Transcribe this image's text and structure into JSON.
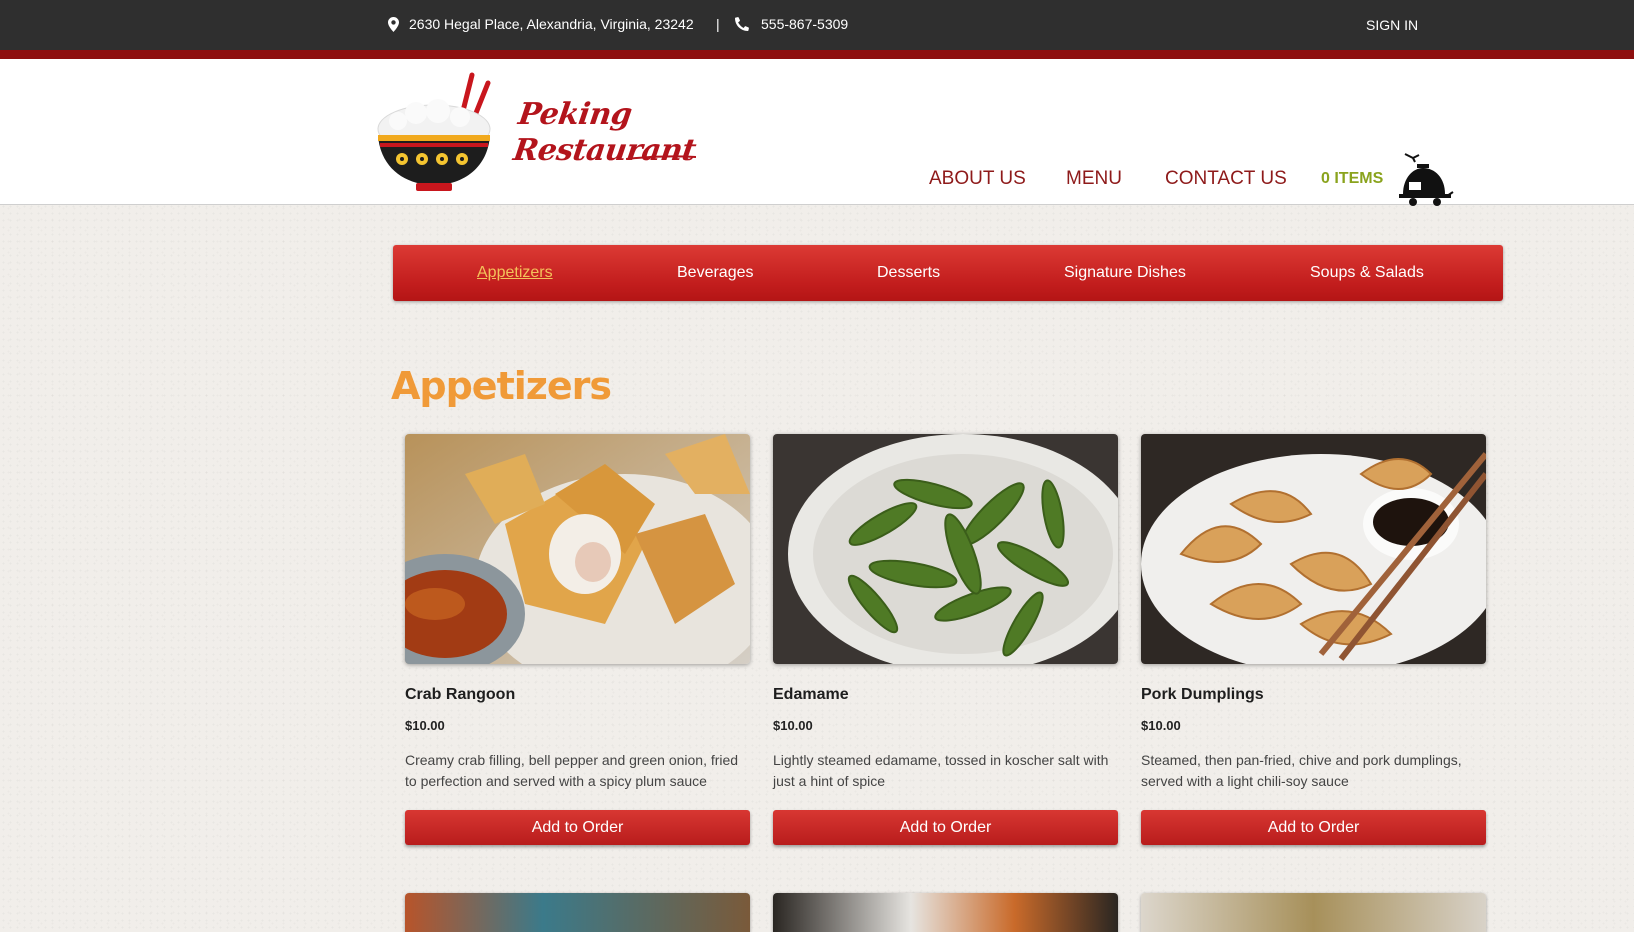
{
  "topbar": {
    "address": "2630 Hegal Place, Alexandria, Virginia, 23242",
    "separator": "|",
    "phone": "555-867-5309",
    "sign_in": "SIGN IN"
  },
  "header": {
    "logo_line1": "Peking",
    "logo_line2": "Restaurant",
    "nav": {
      "about": "ABOUT US",
      "menu": "MENU",
      "contact": "CONTACT US"
    },
    "cart_label": "0 ITEMS"
  },
  "categories": [
    {
      "label": "Appetizers",
      "active": true
    },
    {
      "label": "Beverages",
      "active": false
    },
    {
      "label": "Desserts",
      "active": false
    },
    {
      "label": "Signature Dishes",
      "active": false
    },
    {
      "label": "Soups & Salads",
      "active": false
    }
  ],
  "section_title": "Appetizers",
  "items": [
    {
      "name": "Crab Rangoon",
      "price": "$10.00",
      "description": "Creamy crab filling, bell pepper and green onion, fried to perfection and served with a spicy plum sauce",
      "button": "Add to Order"
    },
    {
      "name": "Edamame",
      "price": "$10.00",
      "description": "Lightly steamed edamame, tossed in koscher salt with just a hint of spice",
      "button": "Add to Order"
    },
    {
      "name": "Pork Dumplings",
      "price": "$10.00",
      "description": "Steamed, then pan-fried, chive and pork dumplings, served with a light chili-soy sauce",
      "button": "Add to Order"
    }
  ],
  "colors": {
    "topbar": "#2f2f2f",
    "accent_red": "#c21d1d",
    "nav_text": "#8e1a1a",
    "cart_green": "#8aa31d",
    "heading_orange": "#f09a38"
  }
}
